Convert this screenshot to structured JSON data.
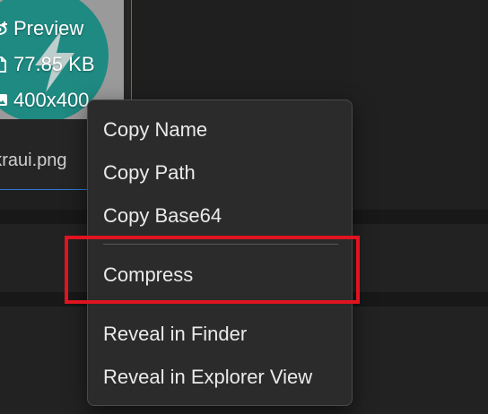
{
  "file_card": {
    "preview_label": "Preview",
    "file_size": "77.85 KB",
    "dimensions": "400x400",
    "file_name": "nakraui.png",
    "preview_icon": "eye-plus-icon",
    "size_icon": "file-icon",
    "dimensions_icon": "image-icon"
  },
  "context_menu": {
    "items": [
      {
        "label": "Copy Name"
      },
      {
        "label": "Copy Path"
      },
      {
        "label": "Copy Base64"
      },
      {
        "label": "Compress"
      },
      {
        "label": "Reveal in Finder"
      },
      {
        "label": "Reveal in Explorer View"
      }
    ]
  },
  "colors": {
    "selection_border": "#2f7bd4",
    "highlight_annotation": "#e0141f",
    "menu_background": "#2b2b2b",
    "thumbnail_accent": "#1f8a82"
  }
}
